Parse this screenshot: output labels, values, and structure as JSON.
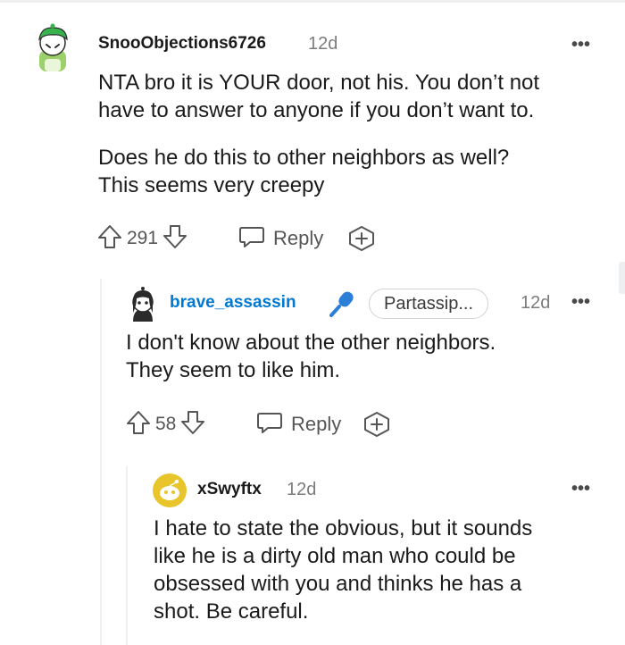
{
  "comments": [
    {
      "author": "SnooObjections6726",
      "age": "12d",
      "paragraphs": [
        [
          "NTA bro it is YOUR door, not his. You don’t not",
          "have to answer to anyone if you don’t want to."
        ],
        [
          "Does he do this to other neighbors as well?",
          "This seems very creepy"
        ]
      ],
      "score": "291",
      "reply_label": "Reply",
      "more_label": "•••",
      "avatar_icon": "snoo-green-avatar-icon"
    },
    {
      "author": "brave_assassin",
      "age": "12d",
      "flair": "Partassip...",
      "badge_icon": "microphone-icon",
      "paragraphs": [
        [
          "I don't know about the other neighbors.",
          "They seem to like him."
        ]
      ],
      "score": "58",
      "reply_label": "Reply",
      "more_label": "•••",
      "avatar_icon": "snoo-dark-avatar-icon"
    },
    {
      "author": "xSwyftx",
      "age": "12d",
      "paragraphs": [
        [
          "I hate to state the obvious, but it sounds",
          "like he is a dirty old man who could be",
          "obsessed with you and thinks he has a",
          "shot. Be careful."
        ]
      ],
      "more_label": "•••",
      "avatar_icon": "snoo-yellow-avatar-icon"
    }
  ],
  "colors": {
    "text": "#1a1a1b",
    "meta": "#7c7c7c",
    "username_blue": "#0079d3",
    "thread_line": "#edeff1",
    "icon_gray": "#555555"
  }
}
